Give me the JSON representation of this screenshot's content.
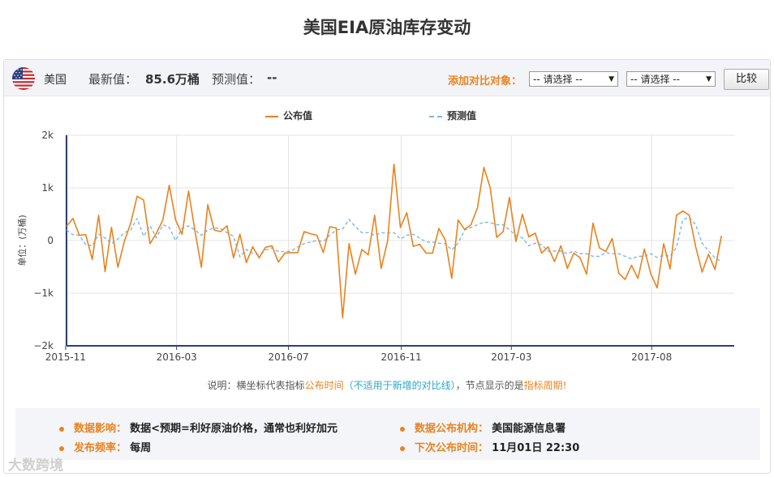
{
  "page_title": "美国EIA原油库存变动",
  "header": {
    "country": "美国",
    "latest_label": "最新值：",
    "latest_value": "85.6万桶",
    "forecast_label": "预测值：",
    "forecast_value": "--",
    "compare_label": "添加对比对象：",
    "select1": "-- 请选择 --",
    "select2": "-- 请选择 --",
    "compare_button": "比较"
  },
  "legend": {
    "actual": "公布值",
    "forecast": "预测值"
  },
  "colors": {
    "actual": "#e8831f",
    "forecast": "#7fb5e3",
    "accent": "#e8831f",
    "note_blue": "#2aa6c9"
  },
  "note": {
    "p1": "说明：横坐标代表指标",
    "p2": "公布时间",
    "p3": "（不适用于新增的对比线）",
    "p4": "，节点显示的是",
    "p5": "指标周期",
    "p6": "!"
  },
  "info": {
    "impact_label": "数据影响：",
    "impact_value": "数据<预期=利好原油价格，通常也利好加元",
    "freq_label": "发布频率：",
    "freq_value": "每周",
    "agency_label": "数据公布机构：",
    "agency_value": "美国能源信息署",
    "next_label": "下次公布时间：",
    "next_value": "11月01日 22:30"
  },
  "watermark": "大数跨境",
  "chart_data": {
    "type": "line",
    "ylabel": "单位：(万桶)",
    "ylim": [
      -2000,
      2000
    ],
    "yticks": [
      2000,
      1000,
      0,
      -1000,
      -2000
    ],
    "ytick_labels": [
      "2k",
      "1k",
      "0",
      "−1k",
      "−2k"
    ],
    "x_start": "2015-11-02",
    "x_end": "2017-10-30",
    "xticks": [
      {
        "date": "2015-11-01",
        "label": "2015-11"
      },
      {
        "date": "2016-03-01",
        "label": "2016-03"
      },
      {
        "date": "2016-07-01",
        "label": "2016-07"
      },
      {
        "date": "2016-11-01",
        "label": "2016-11"
      },
      {
        "date": "2017-03-01",
        "label": "2017-03"
      },
      {
        "date": "2017-08-01",
        "label": "2017-08"
      }
    ],
    "grid": true,
    "series": [
      {
        "name": "公布值",
        "style": "solid",
        "dates": [
          "2015-11-02",
          "2015-11-09",
          "2015-11-16",
          "2015-11-23",
          "2015-11-30",
          "2015-12-07",
          "2015-12-14",
          "2015-12-21",
          "2015-12-28",
          "2016-01-04",
          "2016-01-11",
          "2016-01-18",
          "2016-01-25",
          "2016-02-01",
          "2016-02-08",
          "2016-02-15",
          "2016-02-22",
          "2016-02-29",
          "2016-03-07",
          "2016-03-14",
          "2016-03-21",
          "2016-03-28",
          "2016-04-04",
          "2016-04-11",
          "2016-04-18",
          "2016-04-25",
          "2016-05-02",
          "2016-05-09",
          "2016-05-16",
          "2016-05-23",
          "2016-05-30",
          "2016-06-06",
          "2016-06-13",
          "2016-06-20",
          "2016-06-27",
          "2016-07-04",
          "2016-07-11",
          "2016-07-18",
          "2016-07-25",
          "2016-08-01",
          "2016-08-08",
          "2016-08-15",
          "2016-08-22",
          "2016-08-29",
          "2016-09-05",
          "2016-09-12",
          "2016-09-19",
          "2016-09-26",
          "2016-10-03",
          "2016-10-10",
          "2016-10-17",
          "2016-10-24",
          "2016-10-31",
          "2016-11-07",
          "2016-11-14",
          "2016-11-21",
          "2016-11-28",
          "2016-12-05",
          "2016-12-12",
          "2016-12-19",
          "2016-12-26",
          "2017-01-02",
          "2017-01-09",
          "2017-01-16",
          "2017-01-23",
          "2017-01-30",
          "2017-02-06",
          "2017-02-13",
          "2017-02-20",
          "2017-02-27",
          "2017-03-06",
          "2017-03-13",
          "2017-03-20",
          "2017-03-27",
          "2017-04-03",
          "2017-04-10",
          "2017-04-17",
          "2017-04-24",
          "2017-05-01",
          "2017-05-08",
          "2017-05-15",
          "2017-05-22",
          "2017-05-29",
          "2017-06-05",
          "2017-06-12",
          "2017-06-19",
          "2017-06-26",
          "2017-07-03",
          "2017-07-10",
          "2017-07-17",
          "2017-07-24",
          "2017-07-31",
          "2017-08-07",
          "2017-08-14",
          "2017-08-21",
          "2017-08-28",
          "2017-09-04",
          "2017-09-11",
          "2017-09-18",
          "2017-09-25",
          "2017-10-02",
          "2017-10-09",
          "2017-10-16",
          "2017-10-23",
          "2017-10-30"
        ],
        "values": [
          270,
          420,
          100,
          110,
          -360,
          480,
          -590,
          250,
          -510,
          -20,
          330,
          840,
          770,
          -60,
          140,
          390,
          1050,
          390,
          120,
          940,
          180,
          -510,
          680,
          200,
          170,
          280,
          -330,
          120,
          -420,
          -120,
          -330,
          -130,
          -100,
          -410,
          -240,
          -230,
          -230,
          170,
          130,
          100,
          -230,
          260,
          240,
          -1470,
          -60,
          -640,
          -170,
          -270,
          480,
          -530,
          -10,
          1450,
          250,
          530,
          -110,
          -70,
          -240,
          -240,
          230,
          10,
          -720,
          390,
          210,
          300,
          620,
          1390,
          1000,
          60,
          170,
          820,
          -20,
          500,
          70,
          140,
          -240,
          -120,
          -400,
          -100,
          -530,
          -240,
          -330,
          -640,
          330,
          -140,
          -210,
          40,
          -620,
          -740,
          -470,
          -720,
          -160,
          -630,
          -900,
          -60,
          -540,
          480,
          560,
          480,
          -120,
          -600,
          -260,
          -550,
          90
        ]
      },
      {
        "name": "预测值",
        "style": "dashed",
        "dates": [
          "2015-11-02",
          "2015-11-09",
          "2015-11-16",
          "2015-11-23",
          "2015-11-30",
          "2015-12-07",
          "2015-12-14",
          "2015-12-21",
          "2015-12-28",
          "2016-01-04",
          "2016-01-11",
          "2016-01-18",
          "2016-01-25",
          "2016-02-01",
          "2016-02-08",
          "2016-02-15",
          "2016-02-22",
          "2016-02-29",
          "2016-03-07",
          "2016-03-14",
          "2016-03-21",
          "2016-03-28",
          "2016-04-04",
          "2016-04-11",
          "2016-04-18",
          "2016-04-25",
          "2016-05-02",
          "2016-05-09",
          "2016-05-16",
          "2016-05-23",
          "2016-05-30",
          "2016-06-06",
          "2016-06-13",
          "2016-06-20",
          "2016-06-27",
          "2016-07-04",
          "2016-07-11",
          "2016-07-18",
          "2016-07-25",
          "2016-08-01",
          "2016-08-08",
          "2016-08-15",
          "2016-08-22",
          "2016-08-29",
          "2016-09-05",
          "2016-09-12",
          "2016-09-19",
          "2016-09-26",
          "2016-10-03",
          "2016-10-10",
          "2016-10-17",
          "2016-10-24",
          "2016-10-31",
          "2016-11-07",
          "2016-11-14",
          "2016-11-21",
          "2016-11-28",
          "2016-12-05",
          "2016-12-12",
          "2016-12-19",
          "2016-12-26",
          "2017-01-02",
          "2017-01-09",
          "2017-01-16",
          "2017-01-23",
          "2017-01-30",
          "2017-02-06",
          "2017-02-13",
          "2017-02-20",
          "2017-02-27",
          "2017-03-06",
          "2017-03-13",
          "2017-03-20",
          "2017-03-27",
          "2017-04-03",
          "2017-04-10",
          "2017-04-17",
          "2017-04-24",
          "2017-05-01",
          "2017-05-08",
          "2017-05-15",
          "2017-05-22",
          "2017-05-29",
          "2017-06-05",
          "2017-06-12",
          "2017-06-19",
          "2017-06-26",
          "2017-07-03",
          "2017-07-10",
          "2017-07-17",
          "2017-07-24",
          "2017-07-31",
          "2017-08-07",
          "2017-08-14",
          "2017-08-21",
          "2017-08-28",
          "2017-09-04",
          "2017-09-11",
          "2017-09-18",
          "2017-09-25",
          "2017-10-02",
          "2017-10-09",
          "2017-10-16",
          "2017-10-23",
          "2017-10-30"
        ],
        "values": [
          200,
          110,
          100,
          -80,
          -100,
          120,
          50,
          -60,
          30,
          150,
          200,
          420,
          80,
          280,
          50,
          300,
          250,
          0,
          230,
          280,
          200,
          100,
          200,
          240,
          230,
          150,
          80,
          -310,
          -170,
          -240,
          -270,
          -180,
          -140,
          -210,
          -210,
          -200,
          -120,
          -60,
          -30,
          0,
          -20,
          100,
          200,
          220,
          400,
          260,
          150,
          150,
          100,
          150,
          140,
          150,
          30,
          100,
          120,
          50,
          -30,
          -30,
          -50,
          -60,
          -180,
          -50,
          200,
          250,
          300,
          350,
          340,
          300,
          300,
          200,
          100,
          50,
          -100,
          -50,
          -80,
          -200,
          -200,
          -200,
          -250,
          -200,
          -250,
          -250,
          -300,
          -300,
          -230,
          -250,
          -250,
          -300,
          -350,
          -300,
          -300,
          -250,
          -320,
          -280,
          -300,
          -130,
          400,
          440,
          300,
          -50,
          -200,
          -330,
          -400
        ]
      }
    ]
  }
}
